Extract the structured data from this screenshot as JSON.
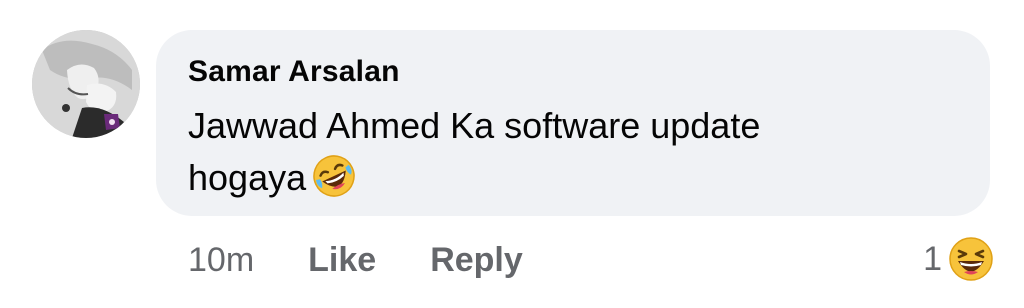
{
  "comment": {
    "author": "Samar Arsalan",
    "text": "Jawwad Ahmed Ka software update hogaya",
    "inline_emoji": "rolling-on-floor-laughing-emoji",
    "timestamp": "10m",
    "like_label": "Like",
    "reply_label": "Reply",
    "reaction_count": "1",
    "reaction_emoji": "grinning-squinting-face-emoji"
  },
  "colors": {
    "bubble_bg": "#f0f2f5",
    "text": "#050505",
    "meta": "#65676b"
  }
}
